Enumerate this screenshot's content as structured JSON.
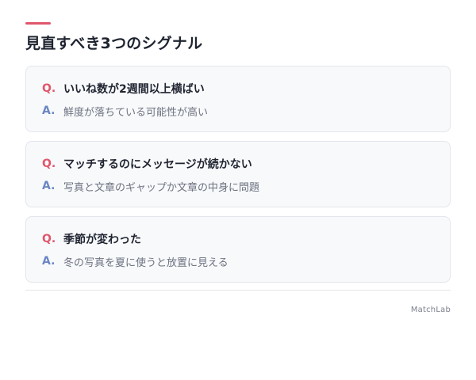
{
  "header": {
    "title": "見直すべき3つのシグナル",
    "accent_color": "#e0566b"
  },
  "qa": {
    "q_marker": "Q.",
    "a_marker": "A.",
    "q_marker_color": "#e0566b",
    "a_marker_color": "#6a86c4",
    "items": [
      {
        "question": "いいね数が2週間以上横ばい",
        "answer": "鮮度が落ちている可能性が高い"
      },
      {
        "question": "マッチするのにメッセージが続かない",
        "answer": "写真と文章のギャップか文章の中身に問題"
      },
      {
        "question": "季節が変わった",
        "answer": "冬の写真を夏に使うと放置に見える"
      }
    ]
  },
  "footer": {
    "brand": "MatchLab"
  }
}
